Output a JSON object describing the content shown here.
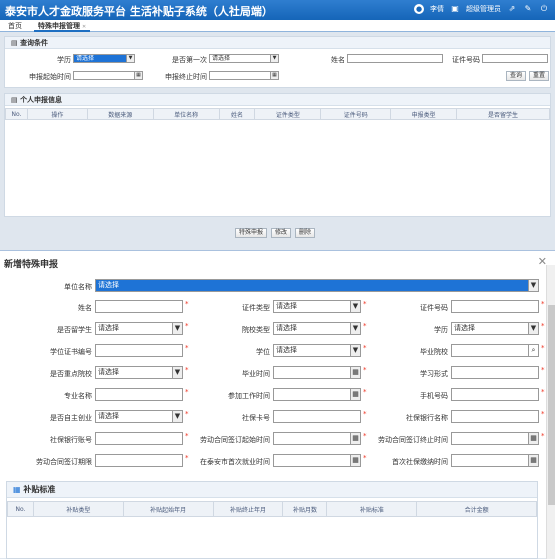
{
  "header": {
    "title": "泰安市人才金政服务平台  生活补贴子系统（人社局端）",
    "user": "李倩",
    "role": "超级管理员"
  },
  "tabs": [
    {
      "label": "首页"
    },
    {
      "label": "特殊申报管理"
    }
  ],
  "query": {
    "title": "查询条件",
    "education_label": "学历",
    "education_value": "请选择",
    "first_label": "是否第一次",
    "first_value": "请选择",
    "name_label": "姓名",
    "idno_label": "证件号码",
    "start_label": "申报起始时间",
    "end_label": "申报终止时间",
    "search_btn": "查询",
    "reset_btn": "重置"
  },
  "info": {
    "title": "个人申报信息",
    "columns": [
      "No.",
      "操作",
      "数据来源",
      "单位名称",
      "姓名",
      "证件类型",
      "证件号码",
      "申报类型",
      "是否留学生"
    ],
    "add_btn": "特殊申报",
    "edit_btn": "修改",
    "delete_btn": "删除"
  },
  "dialog": {
    "title": "新增特殊申报",
    "company_label": "单位名称",
    "company_value": "请选择",
    "fields": {
      "name": "姓名",
      "idtype": "证件类型",
      "idno": "证件号码",
      "overseas": "是否留学生",
      "collegetype": "院校类型",
      "education": "学历",
      "certno": "学位证书编号",
      "degree": "学位",
      "school": "毕业院校",
      "keyschool": "是否重点院校",
      "gradtime": "毕业时间",
      "studymode": "学习形式",
      "major": "专业名称",
      "worktime": "参加工作时间",
      "phone": "手机号码",
      "selfemp": "是否自主创业",
      "sscard": "社保卡号",
      "bank": "社保银行名称",
      "bankacct": "社保银行账号",
      "contractstart": "劳动合同签订起始时间",
      "contractend": "劳动合同签订终止时间",
      "contractterm": "劳动合同签订期限",
      "firstjob": "在泰安市首次就业时间",
      "firstss": "首次社保缴纳时间"
    },
    "select_placeholder": "请选择",
    "subsidy": {
      "title": "补贴标准",
      "columns": [
        "No.",
        "补贴类型",
        "补贴起始年月",
        "补贴终止年月",
        "补贴月数",
        "补贴标准",
        "合计金额"
      ]
    }
  },
  "colors": {
    "header": "#1565b8",
    "highlight": "#1e73d6",
    "required": "#e32"
  }
}
